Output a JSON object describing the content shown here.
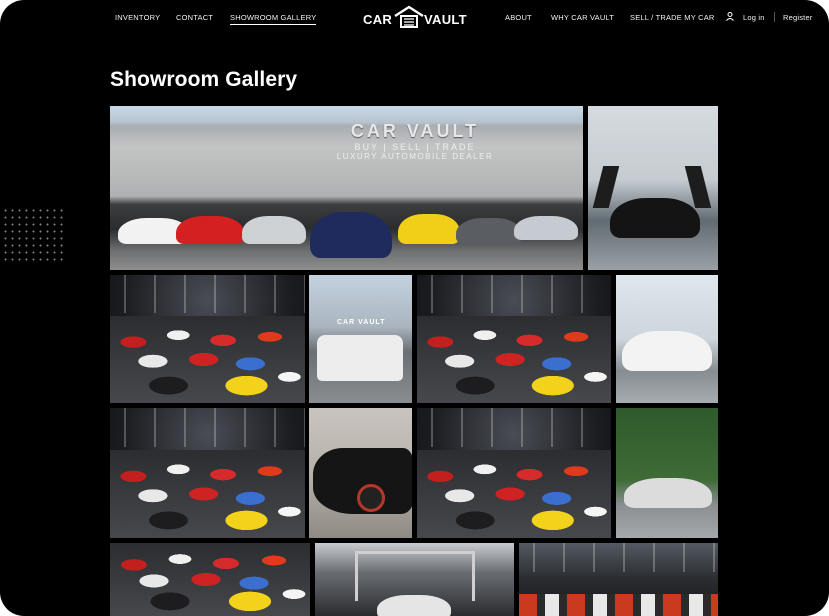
{
  "nav": {
    "left": [
      {
        "label": "INVENTORY",
        "active": false
      },
      {
        "label": "CONTACT",
        "active": false
      },
      {
        "label": "SHOWROOM GALLERY",
        "active": true
      }
    ],
    "logo": {
      "left": "CAR",
      "right": "VAULT"
    },
    "right": [
      {
        "label": "ABOUT"
      },
      {
        "label": "WHY CAR VAULT"
      },
      {
        "label": "SELL / TRADE MY CAR"
      }
    ],
    "login_label": "Log in",
    "register_label": "Register"
  },
  "page": {
    "title": "Showroom Gallery"
  },
  "gallery": {
    "hero_sign": "CAR VAULT",
    "hero_sub1": "BUY | SELL | TRADE",
    "hero_sub2": "LUXURY AUTOMOBILE DEALER",
    "gclass_sign": "CAR VAULT",
    "images": [
      {
        "name": "showroom-exterior-image",
        "subject": "showroom exterior with lineup of supercars"
      },
      {
        "name": "lamborghini-image",
        "subject": "black lamborghini with doors up"
      },
      {
        "name": "garage-image-1",
        "subject": "indoor garage full of cars"
      },
      {
        "name": "gclass-image",
        "subject": "white mercedes g-class"
      },
      {
        "name": "garage-image-2",
        "subject": "indoor garage full of cars"
      },
      {
        "name": "rolls-royce-image",
        "subject": "white rolls-royce convertible"
      },
      {
        "name": "garage-image-3",
        "subject": "indoor garage full of cars"
      },
      {
        "name": "urus-image",
        "subject": "black lamborghini urus"
      },
      {
        "name": "garage-image-4",
        "subject": "indoor garage full of cars"
      },
      {
        "name": "outdoor-lambo-image",
        "subject": "lamborghini outdoors with trees"
      },
      {
        "name": "garage-image-5",
        "subject": "indoor garage full of cars"
      },
      {
        "name": "garage-image-6",
        "subject": "indoor garage"
      },
      {
        "name": "garage-image-7",
        "subject": "indoor garage with cars"
      }
    ]
  },
  "colors": {
    "background": "#000000",
    "text": "#ffffff"
  }
}
